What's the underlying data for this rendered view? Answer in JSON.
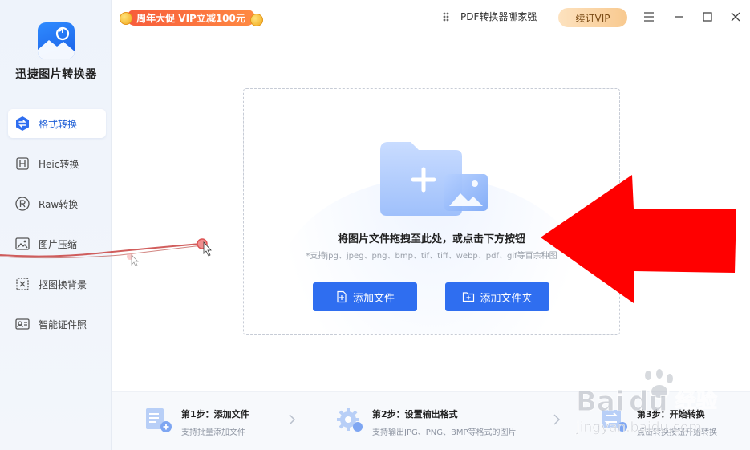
{
  "app": {
    "title": "迅捷图片转换器"
  },
  "sidebar": {
    "items": [
      {
        "label": "格式转换",
        "icon": "format-convert-icon",
        "active": true
      },
      {
        "label": "Heic转换",
        "icon": "heic-icon",
        "active": false
      },
      {
        "label": "Raw转换",
        "icon": "raw-icon",
        "active": false
      },
      {
        "label": "图片压缩",
        "icon": "image-compress-icon",
        "active": false
      },
      {
        "label": "抠图换背景",
        "icon": "cutout-icon",
        "active": false
      },
      {
        "label": "智能证件照",
        "icon": "id-photo-icon",
        "active": false
      }
    ]
  },
  "topbar": {
    "promo": "周年大促 VIP立减100元",
    "pdf_link": "PDF转换器哪家强",
    "vip_button": "续订VIP"
  },
  "dropzone": {
    "title": "将图片文件拖拽至此处，或点击下方按钮",
    "subtitle": "*支持jpg、jpeg、png、bmp、tif、tiff、webp、pdf、gif等百余种图",
    "add_file": "添加文件",
    "add_folder": "添加文件夹"
  },
  "steps": [
    {
      "title": "第1步：添加文件",
      "desc": "支持批量添加文件"
    },
    {
      "title": "第2步：设置输出格式",
      "desc": "支持输出JPG、PNG、BMP等格式的图片"
    },
    {
      "title": "第3步：开始转换",
      "desc": "点击转换按钮开始转换"
    }
  ],
  "watermark": {
    "brand": "Bai",
    "brand2": "du",
    "cn": "经验",
    "url": "jingyan.baidu.com"
  },
  "colors": {
    "primary": "#2f6ef0",
    "arrow": "#ff0000",
    "promo": "#f75b3b",
    "vip": "#f8c98f"
  }
}
